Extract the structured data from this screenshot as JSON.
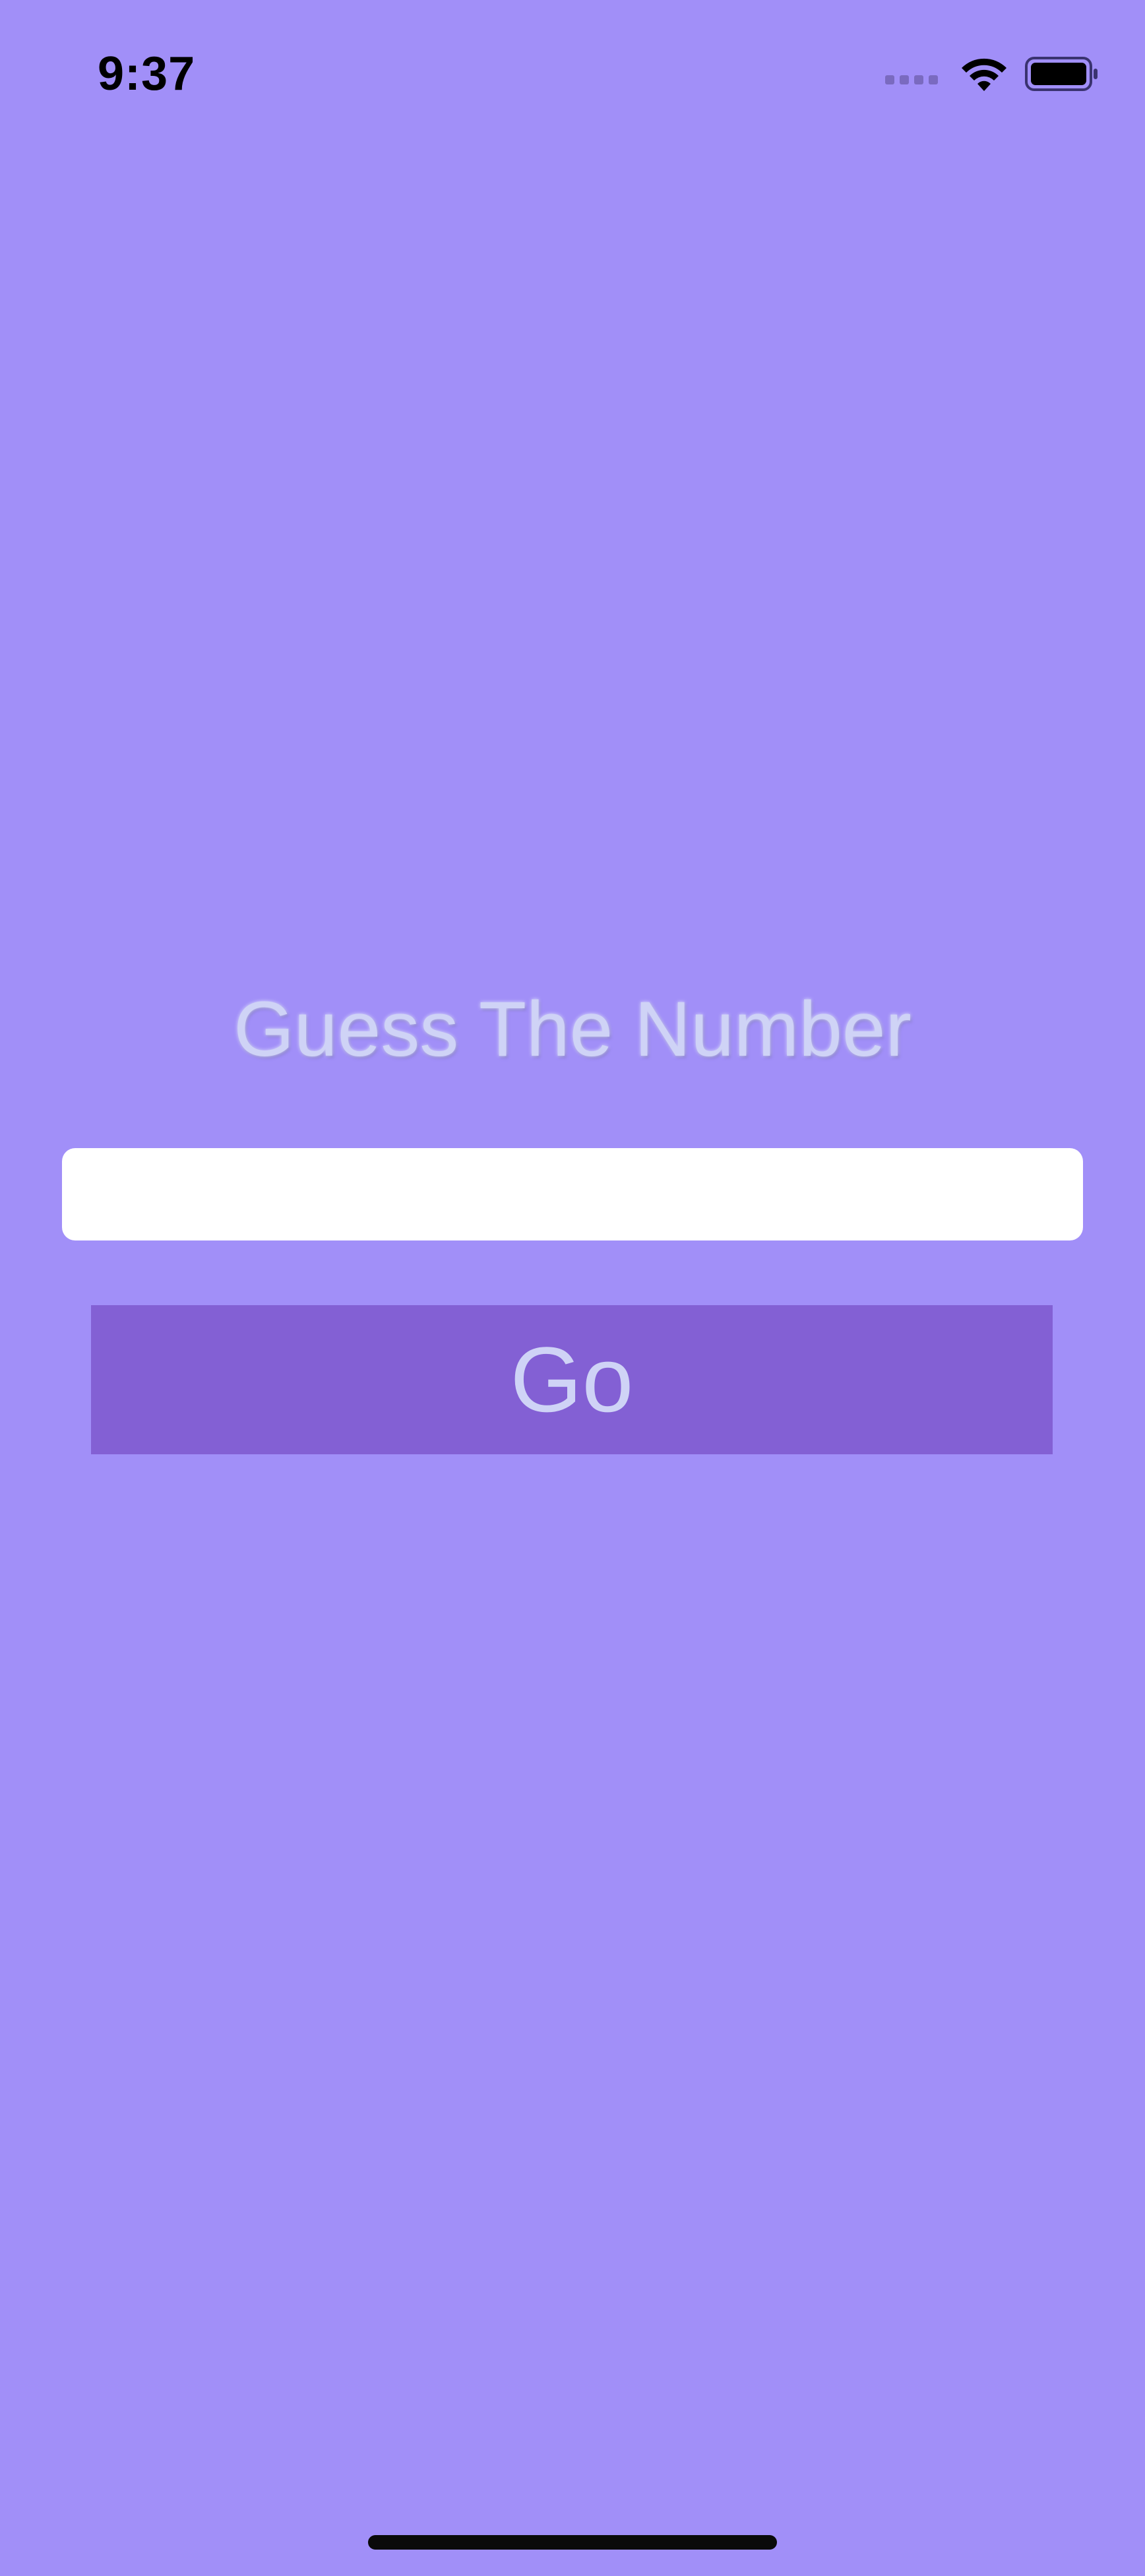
{
  "status_bar": {
    "time": "9:37",
    "icons": [
      "cellular-signal-icon",
      "wifi-icon",
      "battery-icon"
    ]
  },
  "screen": {
    "title": "Guess The Number",
    "input": {
      "value": "",
      "placeholder": ""
    },
    "go_button_label": "Go"
  },
  "colors": {
    "background": "#A18FF8",
    "button": "#8360D4",
    "title_text": "#CFD3F6",
    "input_background": "#FFFFFF"
  }
}
